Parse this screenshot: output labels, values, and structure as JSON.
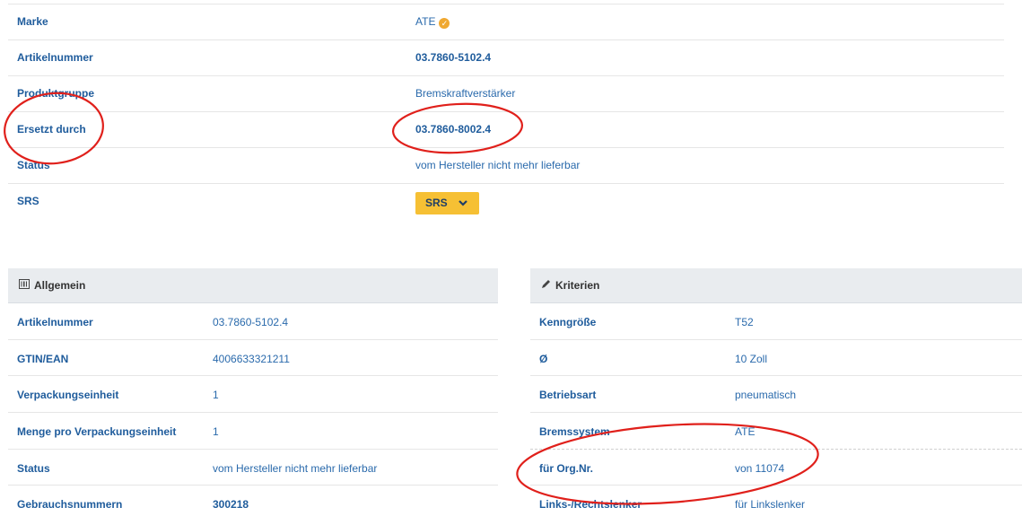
{
  "top_details": {
    "rows": [
      {
        "label": "Marke",
        "value": "ATE"
      },
      {
        "label": "Artikelnummer",
        "value": "03.7860-5102.4"
      },
      {
        "label": "Produktgruppe",
        "value": "Bremskraftverstärker"
      },
      {
        "label": "Ersetzt durch",
        "value": "03.7860-8002.4"
      },
      {
        "label": "Status",
        "value": "vom Hersteller nicht mehr lieferbar"
      },
      {
        "label": "SRS",
        "value": "SRS"
      }
    ],
    "verified_icon": "check-badge-icon",
    "verified_color": "#f0a830",
    "srs_button_color": "#f6c034"
  },
  "allgemein": {
    "title": "Allgemein",
    "icon": "barcode-icon",
    "rows": [
      {
        "label": "Artikelnummer",
        "value": "03.7860-5102.4"
      },
      {
        "label": "GTIN/EAN",
        "value": "4006633321211"
      },
      {
        "label": "Verpackungseinheit",
        "value": "1"
      },
      {
        "label": "Menge pro Verpackungseinheit",
        "value": "1"
      },
      {
        "label": "Status",
        "value": "vom Hersteller nicht mehr lieferbar"
      },
      {
        "label": "Gebrauchsnummern",
        "value": "300218"
      }
    ]
  },
  "kriterien": {
    "title": "Kriterien",
    "icon": "pencil-icon",
    "rows": [
      {
        "label": "Kenngröße",
        "value": "T52"
      },
      {
        "label": "Ø",
        "value": "10 Zoll"
      },
      {
        "label": "Betriebsart",
        "value": "pneumatisch"
      },
      {
        "label": "Bremssystem",
        "value": "ATE"
      },
      {
        "label": "für Org.Nr.",
        "value": "von 11074"
      },
      {
        "label": "Links-/Rechtslenker",
        "value": "für Linkslenker"
      }
    ]
  },
  "colors": {
    "link_blue": "#1f5c9c",
    "annotation_red": "#e0201b",
    "panel_header_bg": "#e9ecef"
  }
}
